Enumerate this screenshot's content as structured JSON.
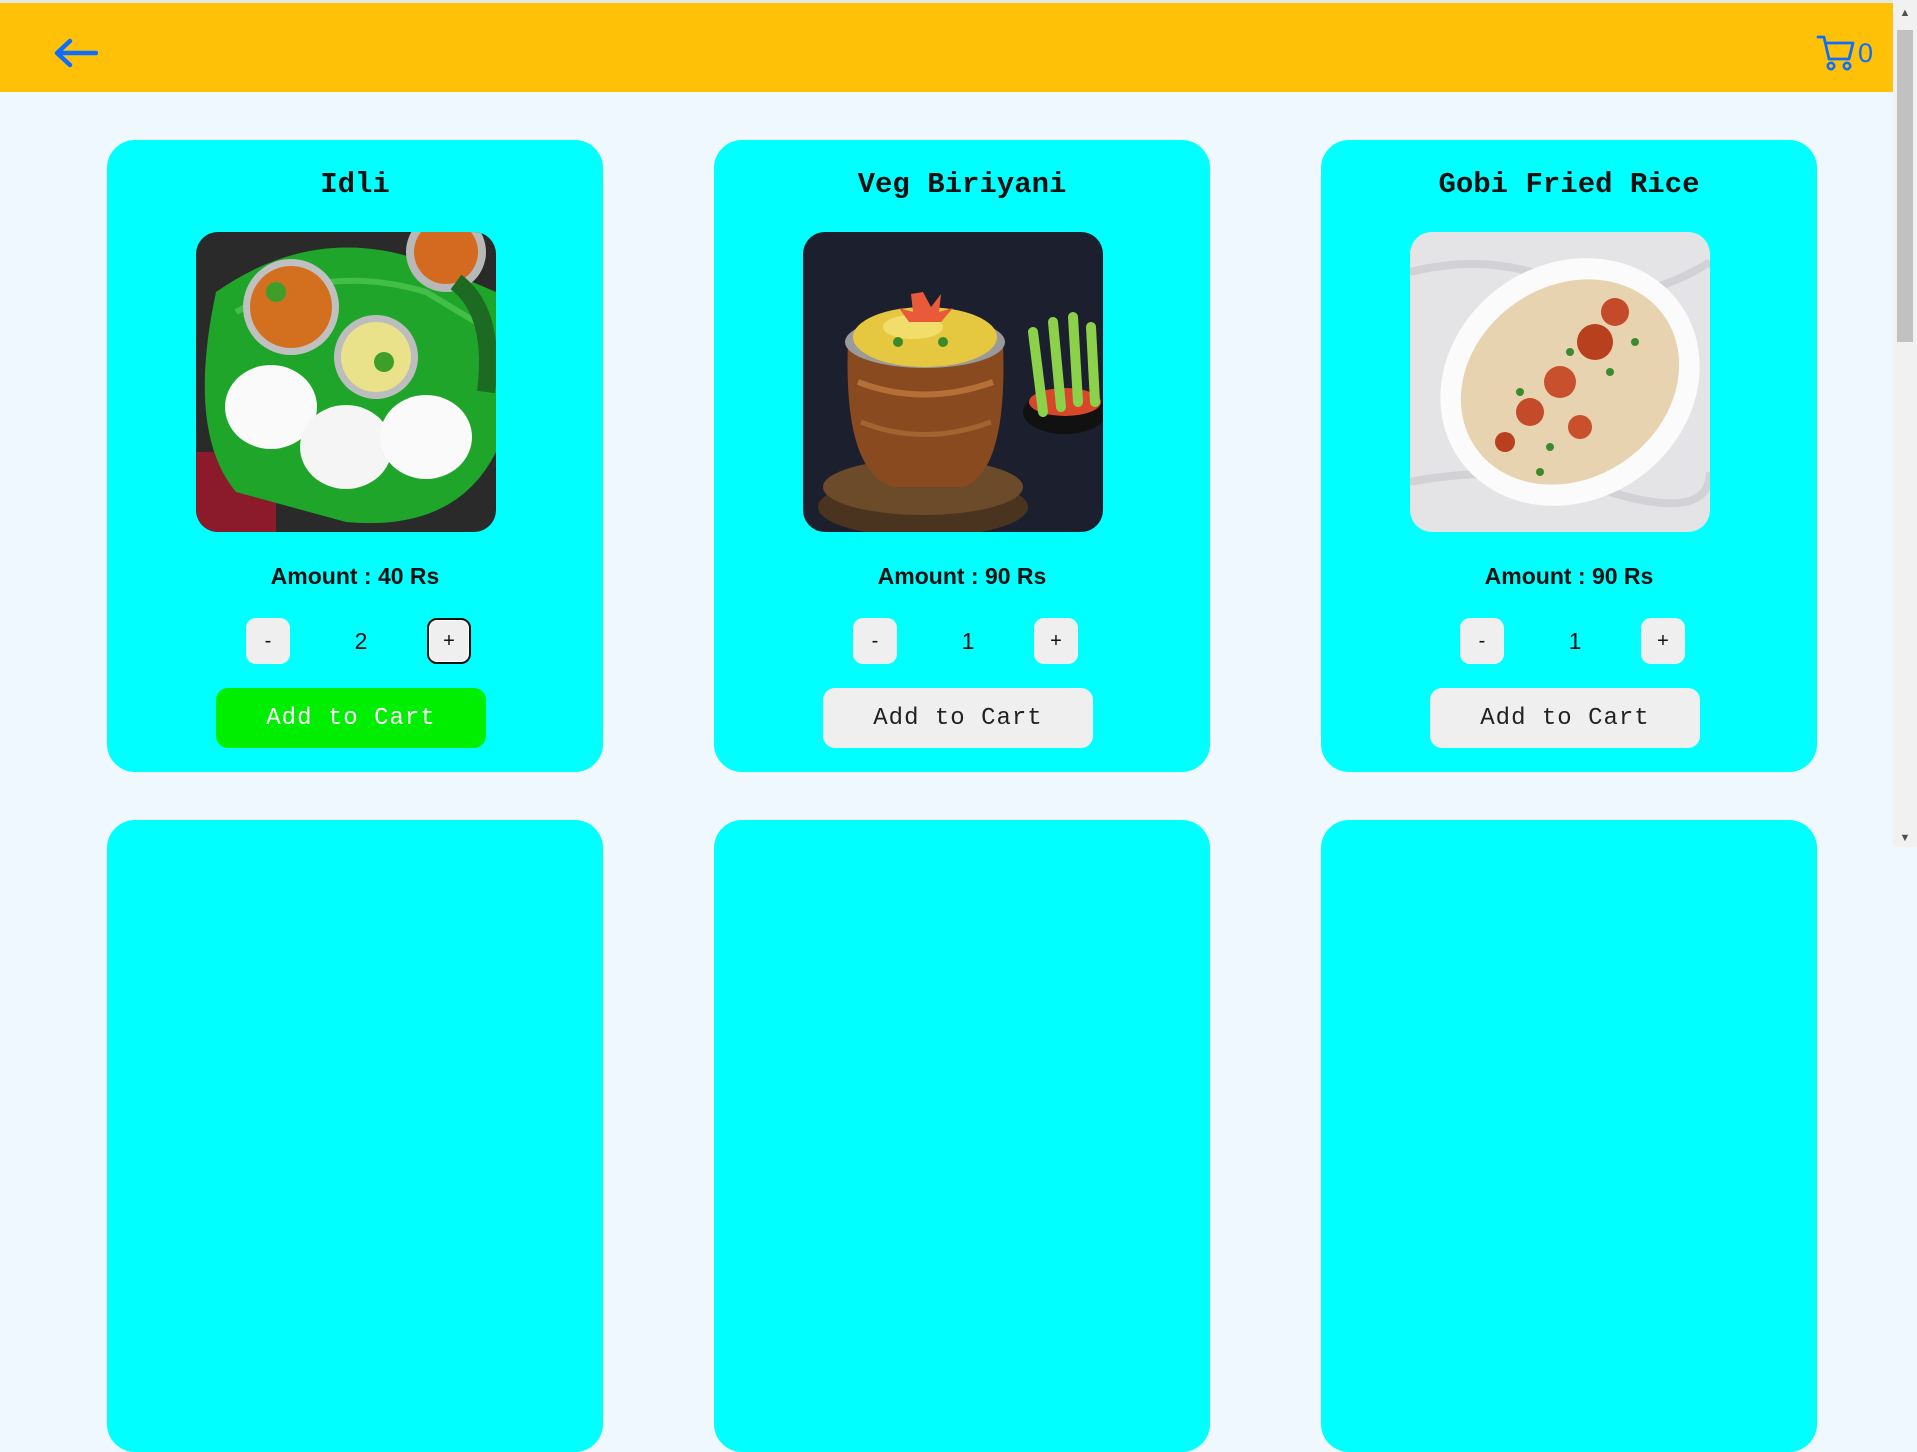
{
  "header": {
    "back_icon": "arrow-left-icon",
    "cart_icon": "cart-icon",
    "cart_count": "0",
    "accent": "#ffc107",
    "icon_color": "#0d6efd"
  },
  "products": [
    {
      "name": "Idli",
      "amount": "Amount : 40 Rs",
      "quantity": "2",
      "minus_label": "-",
      "plus_label": "+",
      "add_label": "Add to Cart",
      "image": "idli-photo"
    },
    {
      "name": "Veg Biriyani",
      "amount": "Amount : 90 Rs",
      "quantity": "1",
      "minus_label": "-",
      "plus_label": "+",
      "add_label": "Add to Cart",
      "image": "veg-biriyani-photo"
    },
    {
      "name": "Gobi Fried Rice",
      "amount": "Amount : 90 Rs",
      "quantity": "1",
      "minus_label": "-",
      "plus_label": "+",
      "add_label": "Add to Cart",
      "image": "gobi-fried-rice-photo"
    }
  ],
  "colors": {
    "card_bg": "#00ffff",
    "page_bg": "#f0f8ff",
    "add_active": "#00ee00"
  }
}
